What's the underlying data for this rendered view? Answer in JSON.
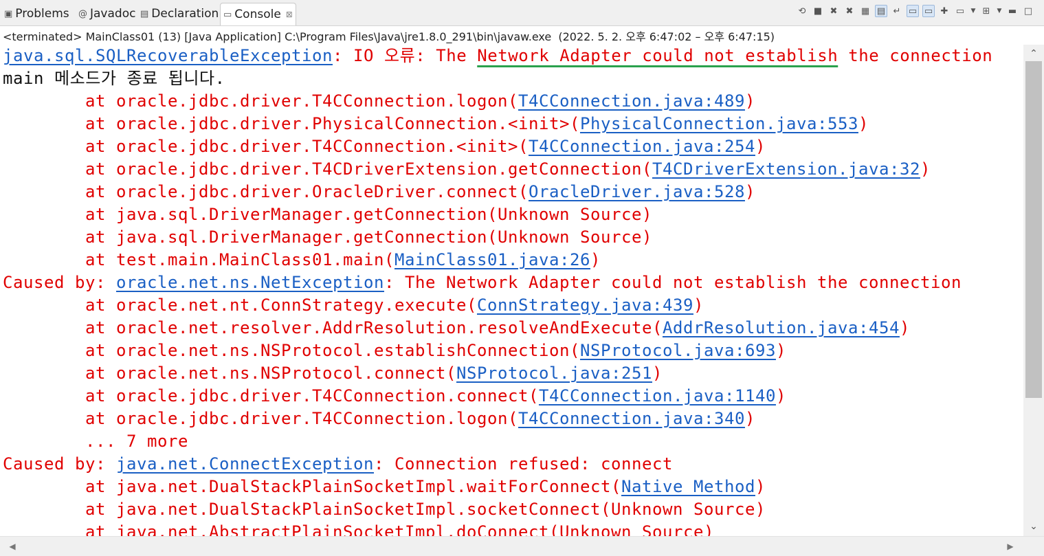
{
  "tabs": [
    {
      "label": "Problems",
      "icon": "problems-icon",
      "glyph": "▣"
    },
    {
      "label": "Javadoc",
      "icon": "javadoc-icon",
      "glyph": "@"
    },
    {
      "label": "Declaration",
      "icon": "declaration-icon",
      "glyph": "▤"
    },
    {
      "label": "Console",
      "icon": "console-icon",
      "glyph": "▭",
      "active": true
    }
  ],
  "tab_close_glyph": "⊠",
  "status_line": "<terminated> MainClass01 (13) [Java Application] C:\\Program Files\\Java\\jre1.8.0_291\\bin\\javaw.exe  (2022. 5. 2. 오후 6:47:02 – 오후 6:47:15)",
  "colors": {
    "error_text": "#e00000",
    "link": "#1a5fc4",
    "normal_text": "#111111",
    "highlight_underline": "#2aa14d"
  },
  "toolbar_icons": [
    {
      "name": "remove-launch-icon",
      "glyph": "⟲"
    },
    {
      "name": "terminate-icon",
      "glyph": "■"
    },
    {
      "name": "remove-all-terminated-icon",
      "glyph": "✖"
    },
    {
      "name": "remove-terminated-icon",
      "glyph": "✖"
    },
    {
      "name": "clear-console-icon",
      "glyph": "▦"
    },
    {
      "name": "scroll-lock-icon",
      "glyph": "▤",
      "on": true
    },
    {
      "name": "word-wrap-icon",
      "glyph": "↵"
    },
    {
      "name": "show-stdout-icon",
      "glyph": "▭",
      "on": true
    },
    {
      "name": "show-stderr-icon",
      "glyph": "▭",
      "on": true
    },
    {
      "name": "pin-console-icon",
      "glyph": "✚"
    },
    {
      "name": "display-console-icon",
      "glyph": "▭"
    },
    {
      "name": "display-console-dropdown-icon",
      "glyph": "▼",
      "drop": true
    },
    {
      "name": "open-console-icon",
      "glyph": "⊞"
    },
    {
      "name": "open-console-dropdown-icon",
      "glyph": "▼",
      "drop": true
    },
    {
      "name": "minimize-icon",
      "glyph": "▬"
    },
    {
      "name": "maximize-icon",
      "glyph": "□"
    }
  ],
  "lines": [
    {
      "indent": false,
      "segments": [
        {
          "text": "java.sql.SQLRecoverableException",
          "style": "link"
        },
        {
          "text": ": IO 오류: The ",
          "style": "error"
        },
        {
          "text": "Network Adapter could not establish",
          "style": "highlight"
        },
        {
          "text": " the connection",
          "style": "error"
        }
      ]
    },
    {
      "indent": false,
      "segments": [
        {
          "text": "main 메소드가 종료 됩니다.",
          "style": "normal"
        }
      ]
    },
    {
      "indent": true,
      "segments": [
        {
          "text": "at oracle.jdbc.driver.T4CConnection.logon(",
          "style": "error"
        },
        {
          "text": "T4CConnection.java:489",
          "style": "link"
        },
        {
          "text": ")",
          "style": "error"
        }
      ]
    },
    {
      "indent": true,
      "segments": [
        {
          "text": "at oracle.jdbc.driver.PhysicalConnection.<init>(",
          "style": "error"
        },
        {
          "text": "PhysicalConnection.java:553",
          "style": "link"
        },
        {
          "text": ")",
          "style": "error"
        }
      ]
    },
    {
      "indent": true,
      "segments": [
        {
          "text": "at oracle.jdbc.driver.T4CConnection.<init>(",
          "style": "error"
        },
        {
          "text": "T4CConnection.java:254",
          "style": "link"
        },
        {
          "text": ")",
          "style": "error"
        }
      ]
    },
    {
      "indent": true,
      "segments": [
        {
          "text": "at oracle.jdbc.driver.T4CDriverExtension.getConnection(",
          "style": "error"
        },
        {
          "text": "T4CDriverExtension.java:32",
          "style": "link"
        },
        {
          "text": ")",
          "style": "error"
        }
      ]
    },
    {
      "indent": true,
      "segments": [
        {
          "text": "at oracle.jdbc.driver.OracleDriver.connect(",
          "style": "error"
        },
        {
          "text": "OracleDriver.java:528",
          "style": "link"
        },
        {
          "text": ")",
          "style": "error"
        }
      ]
    },
    {
      "indent": true,
      "segments": [
        {
          "text": "at java.sql.DriverManager.getConnection(Unknown Source)",
          "style": "error"
        }
      ]
    },
    {
      "indent": true,
      "segments": [
        {
          "text": "at java.sql.DriverManager.getConnection(Unknown Source)",
          "style": "error"
        }
      ]
    },
    {
      "indent": true,
      "segments": [
        {
          "text": "at test.main.MainClass01.main(",
          "style": "error"
        },
        {
          "text": "MainClass01.java:26",
          "style": "link"
        },
        {
          "text": ")",
          "style": "error"
        }
      ]
    },
    {
      "indent": false,
      "segments": [
        {
          "text": "Caused by: ",
          "style": "error"
        },
        {
          "text": "oracle.net.ns.NetException",
          "style": "link"
        },
        {
          "text": ": The Network Adapter could not establish the connection",
          "style": "error"
        }
      ]
    },
    {
      "indent": true,
      "segments": [
        {
          "text": "at oracle.net.nt.ConnStrategy.execute(",
          "style": "error"
        },
        {
          "text": "ConnStrategy.java:439",
          "style": "link"
        },
        {
          "text": ")",
          "style": "error"
        }
      ]
    },
    {
      "indent": true,
      "segments": [
        {
          "text": "at oracle.net.resolver.AddrResolution.resolveAndExecute(",
          "style": "error"
        },
        {
          "text": "AddrResolution.java:454",
          "style": "link"
        },
        {
          "text": ")",
          "style": "error"
        }
      ]
    },
    {
      "indent": true,
      "segments": [
        {
          "text": "at oracle.net.ns.NSProtocol.establishConnection(",
          "style": "error"
        },
        {
          "text": "NSProtocol.java:693",
          "style": "link"
        },
        {
          "text": ")",
          "style": "error"
        }
      ]
    },
    {
      "indent": true,
      "segments": [
        {
          "text": "at oracle.net.ns.NSProtocol.connect(",
          "style": "error"
        },
        {
          "text": "NSProtocol.java:251",
          "style": "link"
        },
        {
          "text": ")",
          "style": "error"
        }
      ]
    },
    {
      "indent": true,
      "segments": [
        {
          "text": "at oracle.jdbc.driver.T4CConnection.connect(",
          "style": "error"
        },
        {
          "text": "T4CConnection.java:1140",
          "style": "link"
        },
        {
          "text": ")",
          "style": "error"
        }
      ]
    },
    {
      "indent": true,
      "segments": [
        {
          "text": "at oracle.jdbc.driver.T4CConnection.logon(",
          "style": "error"
        },
        {
          "text": "T4CConnection.java:340",
          "style": "link"
        },
        {
          "text": ")",
          "style": "error"
        }
      ]
    },
    {
      "indent": true,
      "segments": [
        {
          "text": "... 7 more",
          "style": "error"
        }
      ]
    },
    {
      "indent": false,
      "segments": [
        {
          "text": "Caused by: ",
          "style": "error"
        },
        {
          "text": "java.net.ConnectException",
          "style": "link"
        },
        {
          "text": ": Connection refused: connect",
          "style": "error"
        }
      ]
    },
    {
      "indent": true,
      "segments": [
        {
          "text": "at java.net.DualStackPlainSocketImpl.waitForConnect(",
          "style": "error"
        },
        {
          "text": "Native Method",
          "style": "link"
        },
        {
          "text": ")",
          "style": "error"
        }
      ]
    },
    {
      "indent": true,
      "segments": [
        {
          "text": "at java.net.DualStackPlainSocketImpl.socketConnect(Unknown Source)",
          "style": "error"
        }
      ]
    },
    {
      "indent": true,
      "segments": [
        {
          "text": "at java.net.AbstractPlainSocketImpl.doConnect(Unknown Source)",
          "style": "error"
        }
      ]
    }
  ],
  "scrollbar": {
    "up_glyph": "⌃",
    "down_glyph": "⌄",
    "left_glyph": "◀",
    "right_glyph": "▶"
  }
}
